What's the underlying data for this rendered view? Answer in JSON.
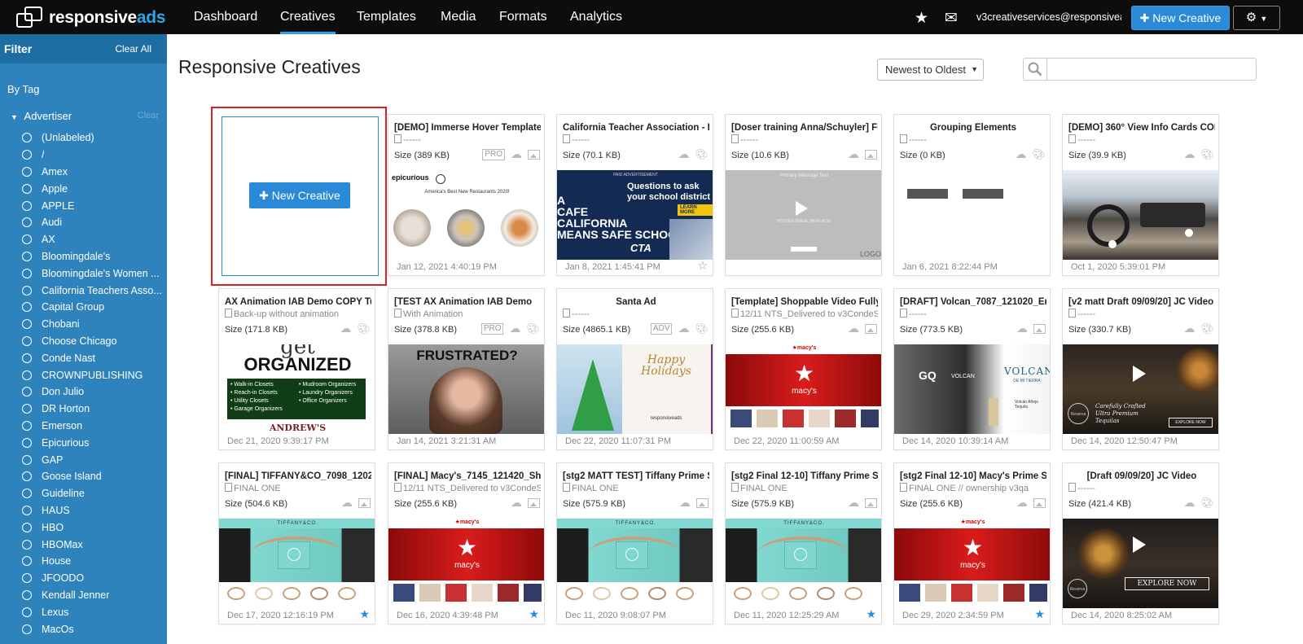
{
  "nav": {
    "logo_main": "responsive",
    "logo_accent": "ads",
    "items": [
      "Dashboard",
      "Creatives",
      "Templates",
      "Media",
      "Formats",
      "Analytics"
    ],
    "active": "Creatives",
    "email": "v3creativeservices@responsivea...",
    "new_creative": "New Creative"
  },
  "sidebar": {
    "filter": "Filter",
    "clear_all": "Clear All",
    "by_tag": "By Tag",
    "advertiser": "Advertiser",
    "clear": "Clear",
    "advertisers": [
      "(Unlabeled)",
      "/",
      "Amex",
      "Apple",
      "APPLE",
      "Audi",
      "AX",
      "Bloomingdale's",
      "Bloomingdale's Women ...",
      "California Teachers Asso...",
      "Capital Group",
      "Chobani",
      "Choose Chicago",
      "Conde Nast",
      "CROWNPUBLISHING",
      "Don Julio",
      "DR Horton",
      "Emerson",
      "Epicurious",
      "GAP",
      "Goose Island",
      "Guideline",
      "HAUS",
      "HBO",
      "HBOMax",
      "House",
      "JFOODO",
      "Kendall Jenner",
      "Lexus",
      "MacOs"
    ]
  },
  "main": {
    "title": "Responsive Creatives",
    "sort": "Newest to Oldest",
    "new_creative": "New Creative"
  },
  "cards": [
    {
      "title": "[DEMO] Immerse Hover Template",
      "desc": "------",
      "size": "Size (389 KB)",
      "badge": "PRO",
      "mode": "image",
      "date": "Jan 12, 2021 4:40:19 PM",
      "star": "",
      "thumb": "epicurious",
      "center": false,
      "thumb_text": [
        "epicurious",
        "America's Best New Restaurants 2020!"
      ]
    },
    {
      "title": "California Teacher Association - Fl",
      "desc": "------",
      "size": "Size (70.1 KB)",
      "badge": "",
      "mode": "palette",
      "date": "Jan 8, 2021 1:45:41 PM",
      "star": "off",
      "thumb": "cta",
      "center": false,
      "thumb_text": [
        "PAID ADVERTISEMENT",
        "Questions to ask",
        "your school district",
        "A",
        "CAFE",
        "CALIFORNIA",
        "MEANS SAFE SCHOOLS",
        "LEARN MORE",
        "CTA"
      ]
    },
    {
      "title": "[Doser training Anna/Schuyler] Fu",
      "desc": "------",
      "size": "Size (10.6 KB)",
      "badge": "",
      "mode": "image",
      "date": "",
      "star": "",
      "thumb": "doser",
      "center": false,
      "thumb_text": [
        "Primary Message Text",
        "POSTER IMAGE (REPLACE)",
        "LOGO"
      ]
    },
    {
      "title": "Grouping Elements",
      "desc": "------",
      "size": "Size (0 KB)",
      "badge": "",
      "mode": "palette",
      "date": "Jan 6, 2021 8:22:44 PM",
      "star": "",
      "thumb": "grouping",
      "center": true,
      "thumb_text": []
    },
    {
      "title": "[DEMO] 360° View Info Cards COP",
      "desc": "------",
      "size": "Size (39.9 KB)",
      "badge": "",
      "mode": "palette",
      "date": "Oct 1, 2020 5:39:01 PM",
      "star": "",
      "thumb": "car",
      "center": false,
      "thumb_text": []
    },
    {
      "title": "AX Animation IAB Demo COPY Tu",
      "desc": "Back-up without animation",
      "size": "Size (171.8 KB)",
      "badge": "",
      "mode": "palette",
      "date": "Dec 21, 2020 9:39:17 PM",
      "star": "",
      "thumb": "andrews",
      "center": false,
      "thumb_text": [
        "get",
        "ORGANIZED",
        "• Walk-in Closets",
        "• Reach-in Closets",
        "• Utility Closets",
        "• Garage Organizers",
        "• Mudroom Organizers",
        "• Laundry Organizers",
        "• Office Organizers",
        "ANDREW'S"
      ]
    },
    {
      "title": "[TEST AX Animation IAB Demo",
      "desc": "With Animation",
      "size": "Size (378.8 KB)",
      "badge": "PRO",
      "mode": "palette",
      "date": "Jan 14, 2021 3:21:31 AM",
      "star": "",
      "thumb": "frustrated",
      "center": false,
      "thumb_text": [
        "FRUSTRATED?"
      ]
    },
    {
      "title": "Santa Ad",
      "desc": "------",
      "size": "Size (4865.1 KB)",
      "badge": "ADV",
      "mode": "palette",
      "date": "Dec 22, 2020 11:07:31 PM",
      "star": "",
      "thumb": "santa",
      "center": true,
      "thumb_text": [
        "Happy",
        "Holidays",
        "responsiveads"
      ]
    },
    {
      "title": "[Template] Shoppable Video Fully",
      "desc": "12/11 NTS_Delivered to v3CondeS",
      "size": "Size (255.6 KB)",
      "badge": "",
      "mode": "image",
      "date": "Dec 22, 2020 11:00:59 AM",
      "star": "",
      "thumb": "macys",
      "center": false,
      "thumb_text": [
        "★macy's",
        "macy's"
      ]
    },
    {
      "title": "[DRAFT] Volcan_7087_121020_Eng",
      "desc": "------",
      "size": "Size (773.5 KB)",
      "badge": "",
      "mode": "image",
      "date": "Dec 14, 2020 10:39:14 AM",
      "star": "",
      "thumb": "volcan",
      "center": false,
      "thumb_text": [
        "GQ",
        "VOLCAN",
        "VOLCAN",
        "DE MI TIERRA",
        "Volcán Añejo Tequila"
      ]
    },
    {
      "title": "[v2 matt Draft 09/09/20] JC Video",
      "desc": "------",
      "size": "Size (330.7 KB)",
      "badge": "",
      "mode": "palette",
      "date": "Dec 14, 2020 12:50:47 PM",
      "star": "",
      "thumb": "jc",
      "center": false,
      "thumb_text": [
        "Carefully Crafted",
        "Ultra Premium",
        "Tequilas",
        "EXPLORE NOW",
        "Reserva"
      ]
    },
    {
      "title": "[FINAL] TIFFANY&CO_7098_12020",
      "desc": "FINAL ONE",
      "size": "Size (504.6 KB)",
      "badge": "",
      "mode": "image",
      "date": "Dec 17, 2020 12:16:19 PM",
      "star": "on",
      "thumb": "tiffany",
      "center": false,
      "thumb_text": [
        "TIFFANY&CO."
      ]
    },
    {
      "title": "[FINAL] Macy's_7145_121420_Sho",
      "desc": "12/11 NTS_Delivered to v3CondeS",
      "size": "Size (255.6 KB)",
      "badge": "",
      "mode": "image",
      "date": "Dec 16, 2020 4:39:48 PM",
      "star": "on",
      "thumb": "macys",
      "center": false,
      "thumb_text": [
        "★macy's",
        "macy's"
      ]
    },
    {
      "title": "[stg2 MATT TEST] Tiffany Prime Sl",
      "desc": "FINAL ONE",
      "size": "Size (575.9 KB)",
      "badge": "",
      "mode": "image",
      "date": "Dec 11, 2020 9:08:07 PM",
      "star": "",
      "thumb": "tiffany",
      "center": false,
      "thumb_text": [
        "TIFFANY&CO."
      ]
    },
    {
      "title": "[stg2 Final 12-10] Tiffany Prime Sh",
      "desc": "FINAL ONE",
      "size": "Size (575.9 KB)",
      "badge": "",
      "mode": "image",
      "date": "Dec 11, 2020 12:25:29 AM",
      "star": "on",
      "thumb": "tiffany",
      "center": false,
      "thumb_text": [
        "TIFFANY&CO."
      ]
    },
    {
      "title": "[stg2 Final 12-10] Macy's Prime Sh",
      "desc": "FINAL ONE // ownership v3qa",
      "size": "Size (255.6 KB)",
      "badge": "",
      "mode": "image",
      "date": "Dec 29, 2020 2:34:59 PM",
      "star": "on",
      "thumb": "macys",
      "center": false,
      "thumb_text": [
        "★macy's",
        "macy's"
      ]
    },
    {
      "title": "[Draft 09/09/20] JC Video",
      "desc": "------",
      "size": "Size (421.4 KB)",
      "badge": "",
      "mode": "palette",
      "date": "Dec 14, 2020 8:25:02 AM",
      "star": "",
      "thumb": "jc2",
      "center": true,
      "thumb_text": [
        "EXPLORE NOW",
        "Reserva"
      ]
    }
  ]
}
